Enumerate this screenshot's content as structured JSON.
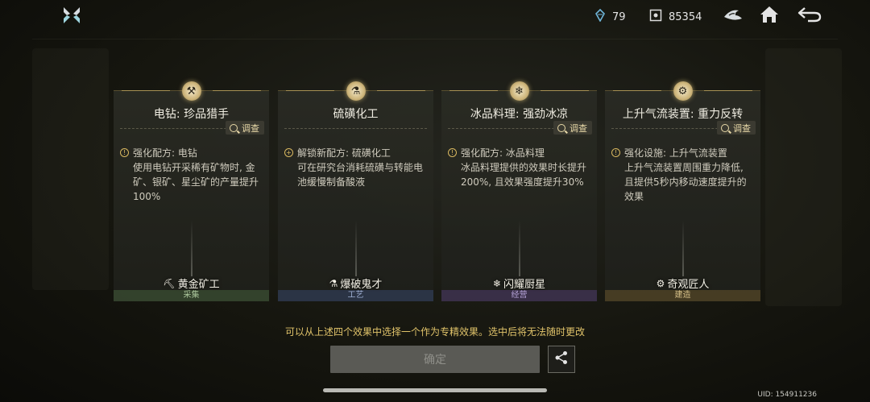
{
  "topbar": {
    "resource1_value": "79",
    "resource2_value": "85354",
    "icons": [
      "game-logo-icon",
      "crystal-icon",
      "currency-icon",
      "shark-icon",
      "home-icon",
      "back-icon"
    ]
  },
  "cards": [
    {
      "title": "电钻: 珍品猎手",
      "probe_label": "调查",
      "desc_head": "强化配方: 电钻",
      "desc_body": "使用电钻开采稀有矿物时, 金矿、银矿、星尘矿的产量提升100%",
      "title2": "黄金矿工",
      "category": "采集",
      "icon": "drill-icon"
    },
    {
      "title": "硫磺化工",
      "probe_label": "调查",
      "desc_head": "解锁新配方: 硫磺化工",
      "desc_body": "可在研究台消耗硫磺与转能电池缓慢制备酸液",
      "title2": "爆破鬼才",
      "category": "工艺",
      "icon": "bottle-icon"
    },
    {
      "title": "冰品料理: 强劲冰凉",
      "probe_label": "调查",
      "desc_head": "强化配方: 冰品料理",
      "desc_body": "冰品料理提供的效果时长提升200%, 且效果强度提升30%",
      "title2": "闪耀厨星",
      "category": "经营",
      "icon": "ice-food-icon"
    },
    {
      "title": "上升气流装置: 重力反转",
      "probe_label": "调查",
      "desc_head": "强化设施: 上升气流装置",
      "desc_body": "上升气流装置周围重力降低, 且提供5秒内移动速度提升的效果",
      "title2": "奇观匠人",
      "category": "建造",
      "icon": "updraft-icon"
    }
  ],
  "notice": "可以从上述四个效果中选择一个作为专精效果。选中后将无法随时更改",
  "confirm_label": "确定",
  "uid": "UID: 154911236",
  "colors": {
    "accent_gold": "#e0c36a",
    "button_gray": "#5a5a55"
  }
}
